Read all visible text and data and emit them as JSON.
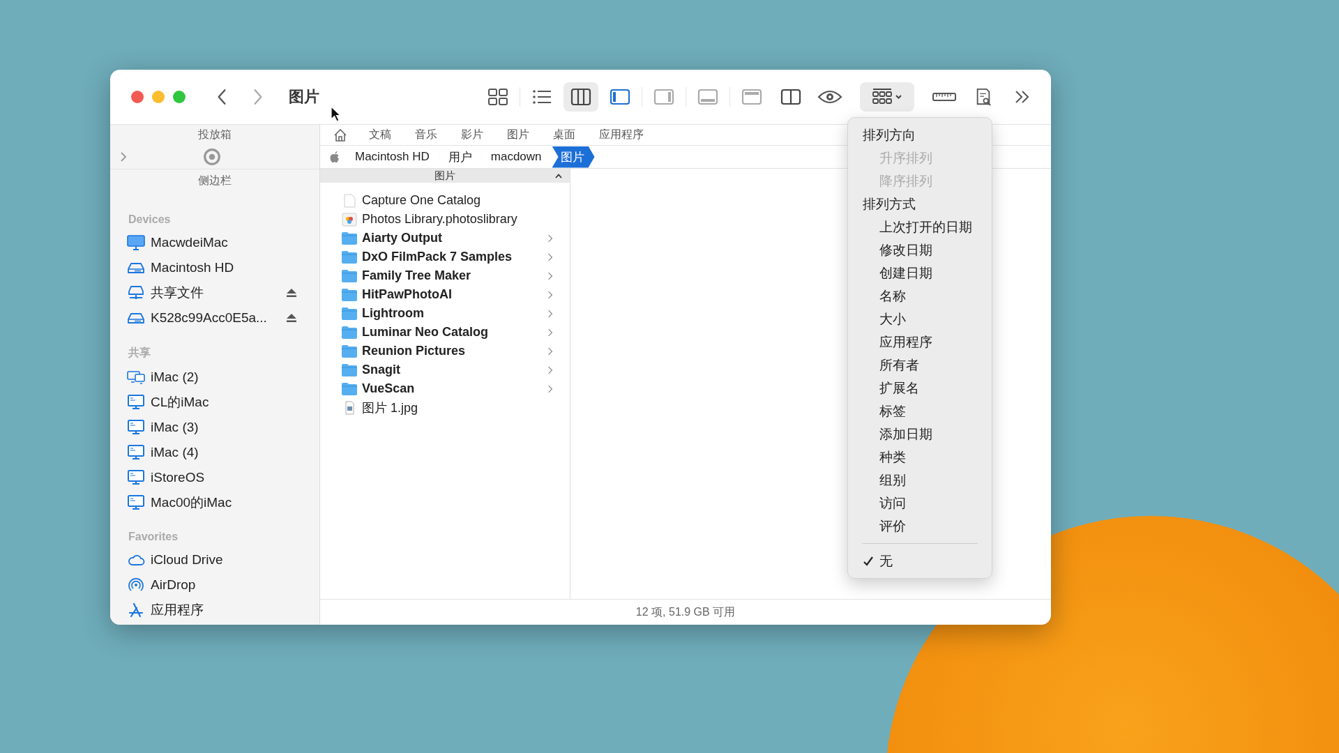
{
  "window": {
    "title": "图片"
  },
  "toolbar": {
    "view_modes": [
      {
        "kind": "icons",
        "selected": false
      },
      {
        "kind": "list",
        "selected": false
      },
      {
        "kind": "columns",
        "selected": true
      }
    ],
    "panel_toggles": [
      {
        "kind": "sidebar",
        "on": true
      },
      {
        "kind": "inspector",
        "on": false
      },
      {
        "kind": "bottom",
        "on": false
      },
      {
        "kind": "top",
        "on": false
      }
    ],
    "group_button": {
      "expanded": true
    }
  },
  "sidebar": {
    "drop_label": "投放箱",
    "panel_label": "侧边栏",
    "sections": [
      {
        "title": "Devices",
        "items": [
          {
            "label": "MacwdeiMac",
            "kind": "imac",
            "eject": false
          },
          {
            "label": "Macintosh HD",
            "kind": "drive",
            "eject": false
          },
          {
            "label": "共享文件",
            "kind": "server",
            "eject": true
          },
          {
            "label": "K528c99Acc0E5a...",
            "kind": "drive",
            "eject": true
          }
        ]
      },
      {
        "title": "共享",
        "items": [
          {
            "label": "iMac (2)",
            "kind": "multi",
            "eject": false
          },
          {
            "label": "CL的iMac",
            "kind": "pc",
            "eject": false
          },
          {
            "label": "iMac (3)",
            "kind": "pc",
            "eject": false
          },
          {
            "label": "iMac (4)",
            "kind": "pc",
            "eject": false
          },
          {
            "label": "iStoreOS",
            "kind": "pc",
            "eject": false
          },
          {
            "label": "Mac00的iMac",
            "kind": "pc",
            "eject": false
          }
        ]
      },
      {
        "title": "Favorites",
        "items": [
          {
            "label": "iCloud Drive",
            "kind": "cloud",
            "eject": false
          },
          {
            "label": "AirDrop",
            "kind": "airdrop",
            "eject": false
          },
          {
            "label": "应用程序",
            "kind": "apps",
            "eject": false
          }
        ]
      }
    ]
  },
  "favorites_bar": [
    "文稿",
    "音乐",
    "影片",
    "图片",
    "桌面",
    "应用程序"
  ],
  "path_bar": [
    {
      "label": "Macintosh HD",
      "selected": false
    },
    {
      "label": "用户",
      "selected": false
    },
    {
      "label": "macdown",
      "selected": false
    },
    {
      "label": "图片",
      "selected": true
    }
  ],
  "column": {
    "title": "图片",
    "items": [
      {
        "name": "Capture One Catalog",
        "kind": "document"
      },
      {
        "name": "Photos Library.photoslibrary",
        "kind": "photos"
      },
      {
        "name": "Aiarty Output",
        "kind": "folder"
      },
      {
        "name": "DxO FilmPack 7 Samples",
        "kind": "folder"
      },
      {
        "name": "Family Tree Maker",
        "kind": "folder"
      },
      {
        "name": "HitPawPhotoAI",
        "kind": "folder"
      },
      {
        "name": "Lightroom",
        "kind": "folder"
      },
      {
        "name": "Luminar Neo Catalog",
        "kind": "folder"
      },
      {
        "name": "Reunion Pictures",
        "kind": "folder"
      },
      {
        "name": "Snagit",
        "kind": "folder"
      },
      {
        "name": "VueScan",
        "kind": "folder"
      },
      {
        "name": "图片 1.jpg",
        "kind": "image"
      }
    ]
  },
  "status_bar": "12 项, 51.9 GB 可用",
  "sort_menu": {
    "groups": [
      {
        "title": "排列方向",
        "options": [
          {
            "label": "升序排列",
            "disabled": true,
            "checked": false
          },
          {
            "label": "降序排列",
            "disabled": true,
            "checked": false
          }
        ]
      },
      {
        "title": "排列方式",
        "options": [
          {
            "label": "上次打开的日期",
            "disabled": false,
            "checked": false
          },
          {
            "label": "修改日期",
            "disabled": false,
            "checked": false
          },
          {
            "label": "创建日期",
            "disabled": false,
            "checked": false
          },
          {
            "label": "名称",
            "disabled": false,
            "checked": false
          },
          {
            "label": "大小",
            "disabled": false,
            "checked": false
          },
          {
            "label": "应用程序",
            "disabled": false,
            "checked": false
          },
          {
            "label": "所有者",
            "disabled": false,
            "checked": false
          },
          {
            "label": "扩展名",
            "disabled": false,
            "checked": false
          },
          {
            "label": "标签",
            "disabled": false,
            "checked": false
          },
          {
            "label": "添加日期",
            "disabled": false,
            "checked": false
          },
          {
            "label": "种类",
            "disabled": false,
            "checked": false
          },
          {
            "label": "组别",
            "disabled": false,
            "checked": false
          },
          {
            "label": "访问",
            "disabled": false,
            "checked": false
          },
          {
            "label": "评价",
            "disabled": false,
            "checked": false
          }
        ]
      }
    ],
    "footer": [
      {
        "label": "无",
        "disabled": false,
        "checked": true
      }
    ]
  }
}
